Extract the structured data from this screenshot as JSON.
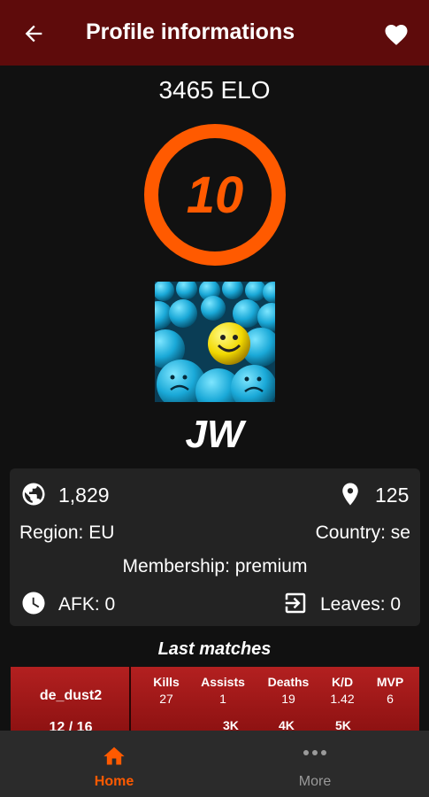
{
  "appbar": {
    "title": "Profile informations",
    "back_icon": "arrow-left-icon",
    "favorite_icon": "heart-icon"
  },
  "profile": {
    "elo_text": "3465 ELO",
    "level": "10",
    "nickname": "JW",
    "accent_color": "#ff5a00"
  },
  "stats": {
    "rank_global": "1,829",
    "rank_country": "125",
    "region": "Region: EU",
    "country": "Country: se",
    "membership": "Membership: premium",
    "afk": "AFK: 0",
    "leaves": "Leaves: 0"
  },
  "last_matches": {
    "title": "Last matches",
    "items": [
      {
        "map": "de_dust2",
        "score": "12 / 16",
        "headers": [
          "Kills",
          "Assists",
          "Deaths",
          "K/D",
          "MVP"
        ],
        "values": [
          "27",
          "1",
          "19",
          "1.42",
          "6"
        ],
        "extra": [
          "3K",
          "4K",
          "5K"
        ]
      }
    ]
  },
  "bottom_nav": {
    "home": "Home",
    "more": "More"
  }
}
